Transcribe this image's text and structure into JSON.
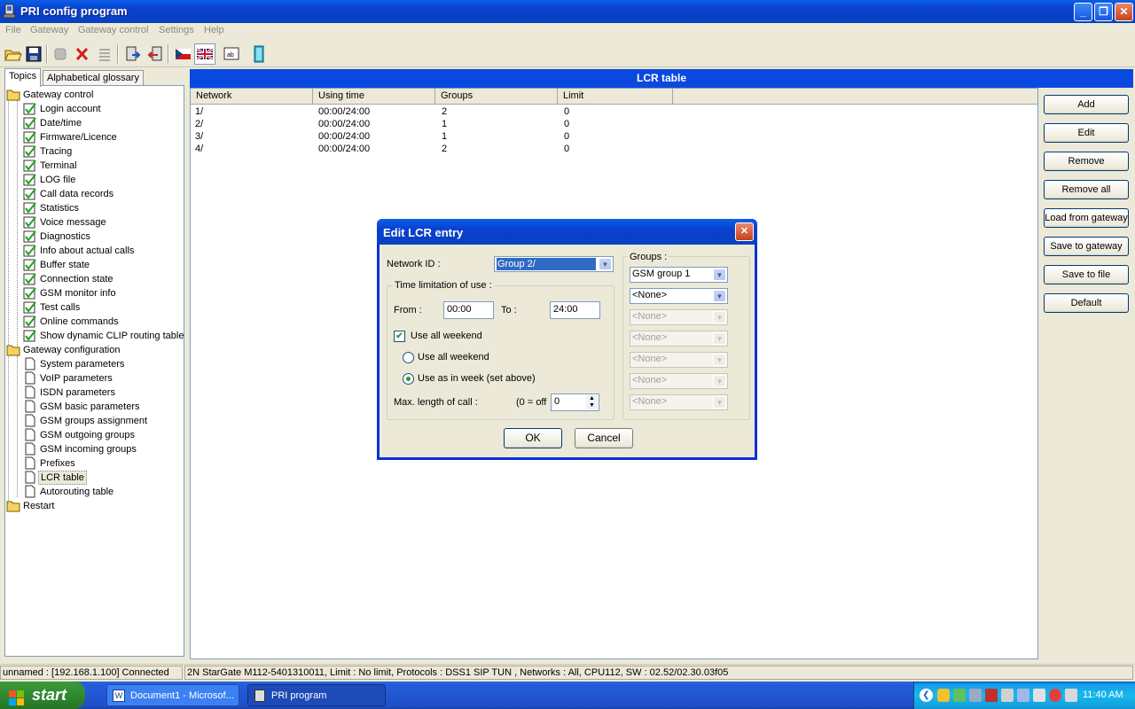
{
  "window": {
    "title": "PRI config program"
  },
  "menu": [
    "File",
    "Gateway",
    "Gateway control",
    "Settings",
    "Help"
  ],
  "left_tabs": [
    "Topics",
    "Alphabetical glossary"
  ],
  "tree": {
    "gateway_control": {
      "label": "Gateway control",
      "items": [
        "Login account",
        "Date/time",
        "Firmware/Licence",
        "Tracing",
        "Terminal",
        "LOG file",
        "Call data records",
        "Statistics",
        "Voice message",
        "Diagnostics",
        "Info about actual calls",
        "Buffer state",
        "Connection state",
        "GSM monitor info",
        "Test calls",
        "Online commands",
        "Show dynamic CLIP routing table"
      ]
    },
    "gateway_configuration": {
      "label": "Gateway configuration",
      "items": [
        "System parameters",
        "VoIP parameters",
        "ISDN parameters",
        "GSM basic parameters",
        "GSM groups assignment",
        "GSM outgoing groups",
        "GSM incoming groups",
        "Prefixes",
        "LCR table",
        "Autorouting table"
      ]
    },
    "restart": {
      "label": "Restart"
    }
  },
  "main": {
    "header": "LCR table",
    "columns": [
      "Network",
      "Using time",
      "Groups",
      "Limit"
    ],
    "rows": [
      [
        "1/",
        "00:00/24:00",
        "2",
        "0"
      ],
      [
        "2/",
        "00:00/24:00",
        "1",
        "0"
      ],
      [
        "3/",
        "00:00/24:00",
        "1",
        "0"
      ],
      [
        "4/",
        "00:00/24:00",
        "2",
        "0"
      ]
    ]
  },
  "actions": [
    "Add",
    "Edit",
    "Remove",
    "Remove all",
    "Load from gateway",
    "Save to gateway",
    "Save to file",
    "Default"
  ],
  "dialog": {
    "title": "Edit LCR entry",
    "network_id_label": "Network ID :",
    "network_id_value": "Group 2/",
    "time_group_label": "Time limitation of use :",
    "from_label": "From :",
    "from_value": "00:00",
    "to_label": "To :",
    "to_value": "24:00",
    "use_all_weekend_check": "Use all weekend",
    "radio_all_weekend": "Use all weekend",
    "radio_as_week": "Use as in week (set above)",
    "max_len_label": "Max. length of call :",
    "max_len_hint": "(0 = off",
    "max_len_value": "0",
    "groups_label": "Groups :",
    "groups": [
      "GSM group 1",
      "<None>",
      "<None>",
      "<None>",
      "<None>",
      "<None>",
      "<None>"
    ],
    "ok": "OK",
    "cancel": "Cancel"
  },
  "status": {
    "left": "unnamed : [192.168.1.100] Connected",
    "right": "2N StarGate M112-5401310011, Limit : No limit, Protocols : DSS1 SIP TUN , Networks : All, CPU112, SW : 02.52/02.30.03f05"
  },
  "taskbar": {
    "start": "start",
    "tasks": [
      "Document1 - Microsof...",
      "PRI program"
    ],
    "clock": "11:40 AM"
  },
  "colors": {
    "accent": "#0A49E0",
    "face": "#ECE9D8",
    "check": "#21A121"
  }
}
